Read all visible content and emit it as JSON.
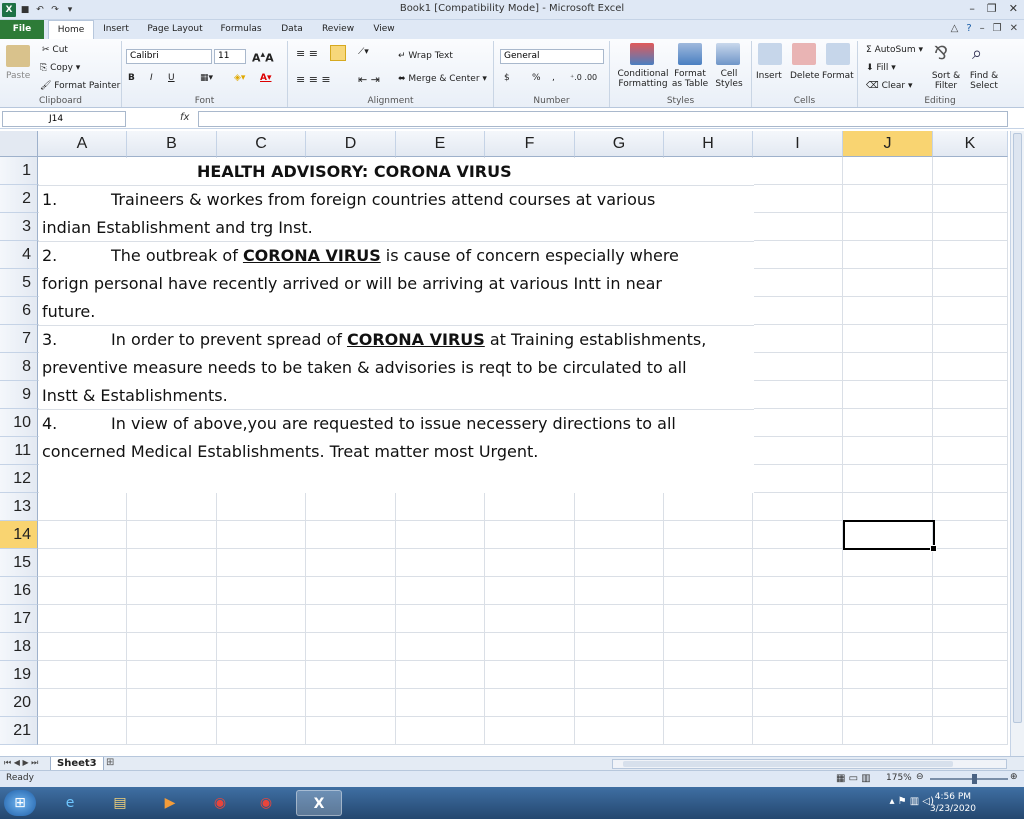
{
  "window": {
    "title": "Book1  [Compatibility Mode]  -  Microsoft Excel"
  },
  "tabs": [
    "File",
    "Home",
    "Insert",
    "Page Layout",
    "Formulas",
    "Data",
    "Review",
    "View"
  ],
  "ribbon": {
    "clipboard": {
      "paste": "Paste",
      "cut": "Cut",
      "copy": "Copy",
      "format_painter": "Format Painter",
      "label": "Clipboard"
    },
    "font": {
      "name": "Calibri",
      "size": "11",
      "bold": "B",
      "italic": "I",
      "underline": "U",
      "label": "Font"
    },
    "alignment": {
      "wrap": "Wrap Text",
      "merge": "Merge & Center",
      "label": "Alignment"
    },
    "number": {
      "format": "General",
      "currency": "$",
      "percent": "%",
      "comma": ",",
      "label": "Number"
    },
    "styles": {
      "conditional": "Conditional Formatting",
      "as_table": "Format as Table",
      "cell_styles": "Cell Styles",
      "label": "Styles"
    },
    "cells": {
      "insert": "Insert",
      "delete": "Delete",
      "format": "Format",
      "label": "Cells"
    },
    "editing": {
      "autosum": "AutoSum",
      "fill": "Fill",
      "clear": "Clear",
      "sort": "Sort & Filter",
      "find": "Find & Select",
      "label": "Editing"
    }
  },
  "formula_bar": {
    "name_box": "J14",
    "fx": "fx",
    "value": ""
  },
  "columns": [
    "A",
    "B",
    "C",
    "D",
    "E",
    "F",
    "G",
    "H",
    "I",
    "J",
    "K"
  ],
  "rows": [
    "1",
    "2",
    "3",
    "4",
    "5",
    "6",
    "7",
    "8",
    "9",
    "10",
    "11",
    "12",
    "13",
    "14",
    "15",
    "16",
    "17",
    "18",
    "19",
    "20",
    "21"
  ],
  "selected_cell": "J14",
  "cells": {
    "r1": "HEALTH ADVISORY: CORONA VIRUS",
    "r2_num": "1.",
    "r2": "Traineers & workes  from foreign countries attend courses at various",
    "r3": "indian Establishment and trg Inst.",
    "r4_num": "2.",
    "r4_pre": "The outbreak of ",
    "r4_bold": "CORONA VIRUS",
    "r4_post": " is cause of concern especially where",
    "r5": "forign personal have recently arrived or will be arriving at various Intt in near",
    "r6": "future.",
    "r7_num": "3.",
    "r7_pre": "In order to prevent spread of ",
    "r7_bold": "CORONA VIRUS",
    "r7_post": " at Training establishments,",
    "r8": "preventive measure needs to be taken & advisories is reqt to be circulated to all",
    "r9": "Instt & Establishments.",
    "r10_num": "4.",
    "r10": "In view of above,you are requested to issue necessery directions to all",
    "r11": "concerned Medical Establishments. Treat matter most Urgent."
  },
  "sheet_tab": "Sheet3",
  "status": {
    "ready": "Ready",
    "zoom": "175%"
  },
  "taskbar": {
    "time": "4:56 PM",
    "date": "3/23/2020"
  }
}
